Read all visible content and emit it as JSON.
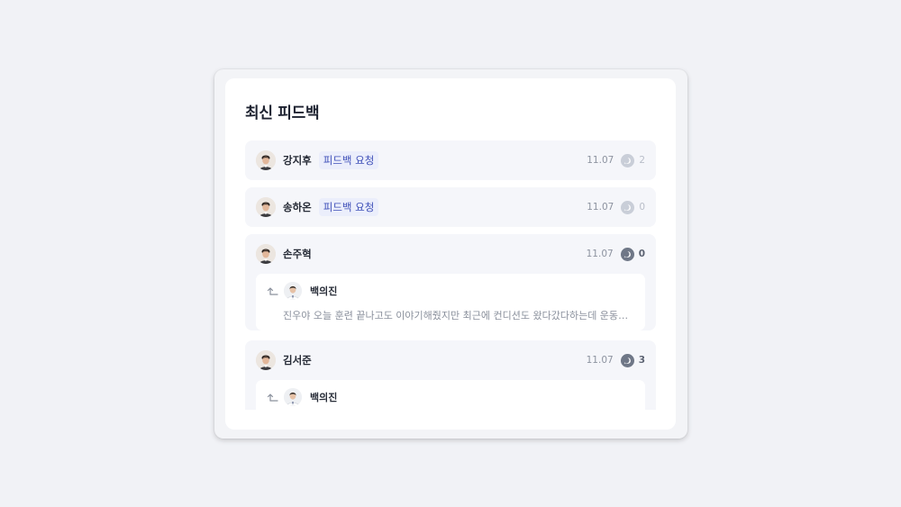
{
  "card": {
    "title": "최신 피드백"
  },
  "items": [
    {
      "name": "강지후",
      "tag": "피드백 요청",
      "date": "11.07",
      "count": "2",
      "count_style": "muted"
    },
    {
      "name": "송하온",
      "tag": "피드백 요청",
      "date": "11.07",
      "count": "0",
      "count_style": "muted"
    },
    {
      "name": "손주혁",
      "date": "11.07",
      "count": "0",
      "count_style": "dark",
      "reply": {
        "name": "백의진",
        "text": "진우야 오늘 훈련 끝나고도 이야기해줬지만 최근에 컨디션도 왔다갔다하는데 운동량이..."
      }
    },
    {
      "name": "김서준",
      "date": "11.07",
      "count": "3",
      "count_style": "dark",
      "reply": {
        "name": "백의진"
      }
    }
  ],
  "icons": {
    "avatar": "person-avatar-icon",
    "comment": "comment-icon",
    "reply": "reply-arrow-icon"
  },
  "colors": {
    "tag_bg": "#ebeefb",
    "tag_text": "#3e4fb8",
    "item_bg": "#f5f6fa"
  }
}
